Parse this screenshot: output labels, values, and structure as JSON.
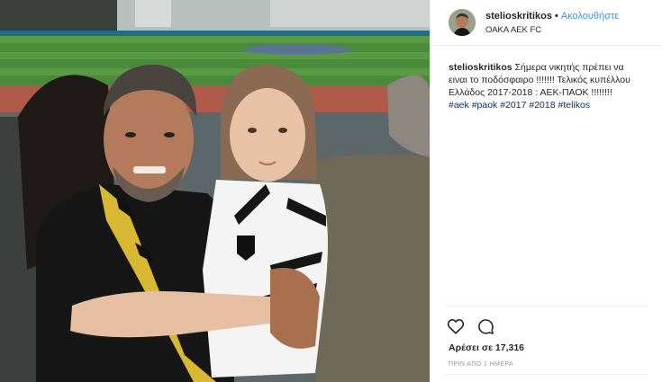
{
  "post": {
    "username": "stelioskritikos",
    "separator": "•",
    "follow_label": "Ακολουθήστε",
    "location": "ΟΑΚΑ ΑΕΚ FC",
    "caption_user": "stelioskritikos",
    "caption_text": "Σήμερα νικητής πρέπει να ειναι το ποδόσφαιρο !!!!!!! Τελικός κυπέλλου Ελλάδος 2017-2018 : ΑΕΚ-ΠΑΟΚ !!!!!!!!",
    "hashtags": [
      "#aek",
      "#paok",
      "#2017",
      "#2018",
      "#telikos"
    ],
    "likes": "Αρέσει σε 17,316",
    "timestamp": "ΠΡΙΝ ΑΠΟ 1 ΗΜΕΡΑ",
    "icons": {
      "like": "heart-icon",
      "comment": "comment-icon"
    }
  },
  "colors": {
    "link": "#3897f0",
    "hashtag": "#003569",
    "text": "#262626",
    "muted": "#999999"
  }
}
